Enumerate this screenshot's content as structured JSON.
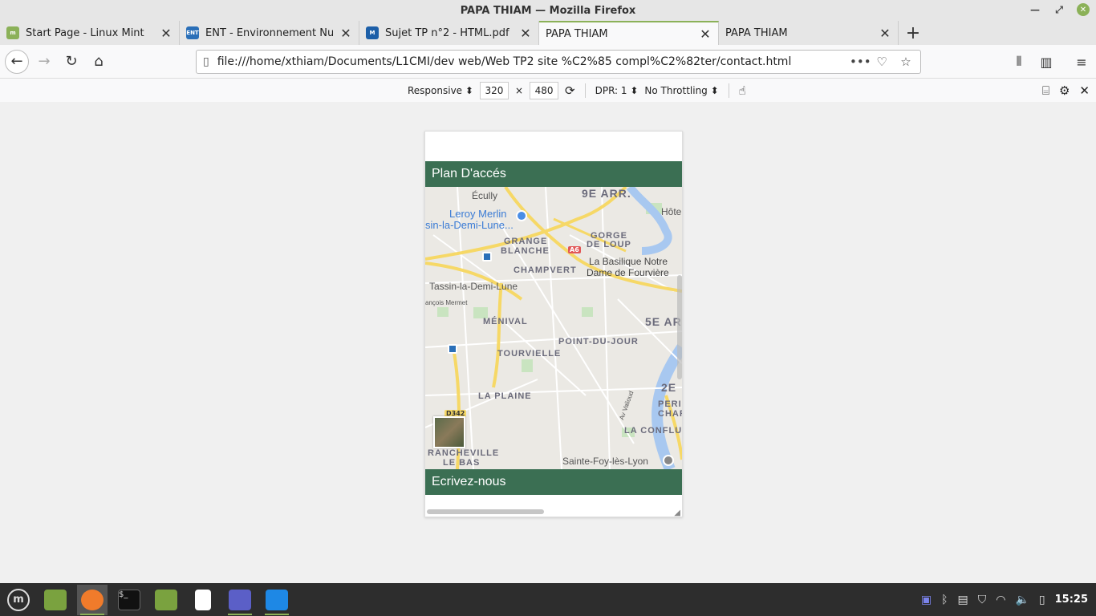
{
  "window": {
    "title": "PAPA THIAM — Mozilla Firefox"
  },
  "tabs": [
    {
      "label": "Start Page - Linux Mint",
      "icon": "linux-mint-icon",
      "color": "#8bb158"
    },
    {
      "label": "ENT - Environnement Num",
      "icon": "ent-icon",
      "color": "#2a6fb8"
    },
    {
      "label": "Sujet TP n°2 - HTML.pdf",
      "icon": "moodle-icon",
      "color": "#1d5fa8"
    },
    {
      "label": "PAPA THIAM",
      "icon": "",
      "color": ""
    },
    {
      "label": "PAPA THIAM",
      "icon": "",
      "color": ""
    }
  ],
  "url": "file:///home/xthiam/Documents/L1CMI/dev web/Web TP2 site %C2%85 compl%C2%82ter/contact.html",
  "rdm": {
    "device": "Responsive",
    "width": "320",
    "times": "×",
    "height": "480",
    "dpr": "DPR: 1",
    "throttling": "No Throttling"
  },
  "page": {
    "section1": "Plan D'accés",
    "section2": "Ecrivez-nous"
  },
  "map": {
    "labels": {
      "ecully": "Écully",
      "arr9": "9E ARR.",
      "hotel": "Hôte",
      "leroy1": "Leroy Merlin",
      "leroy2": "sin-la-Demi-Lune...",
      "gorge1": "GORGE",
      "gorge2": "DE LOUP",
      "grange1": "GRANGE",
      "grange2": "BLANCHE",
      "a6": "A6",
      "basilique1": "La Basilique Notre",
      "basilique2": "Dame de Fourvière",
      "champvert": "CHAMPVERT",
      "tassin": "Tassin-la-Demi-Lune",
      "mermet": "ançois Mermet",
      "menival": "MÉNIVAL",
      "arr5": "5E AR",
      "pointdujour": "POINT-DU-JOUR",
      "tourvielle": "TOURVIELLE",
      "arr2": "2E",
      "peri1": "PERI",
      "peri2": "CHAR",
      "plaine": "LA PLAINE",
      "valioud": "Av Valioud",
      "d342": "D342",
      "conflu": "LA CONFLU",
      "francheville1": "RANCHEVILLE",
      "francheville2": "LE BAS",
      "saintefoy": "Sainte-Foy-lès-Lyon"
    }
  },
  "taskbar": {
    "clock": "15:25"
  },
  "colors": {
    "accent": "#8bb158",
    "section": "#3b6f53"
  }
}
